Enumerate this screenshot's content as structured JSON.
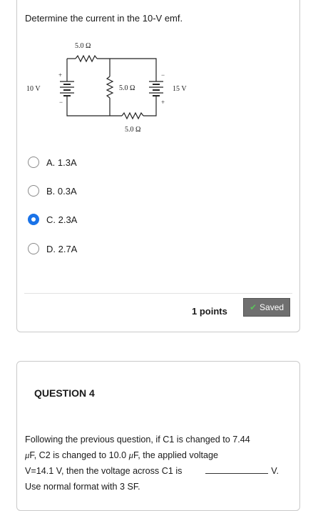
{
  "question3": {
    "text": "Determine the current in the 10-V emf.",
    "circuit": {
      "r_top": "5.0 Ω",
      "r_middle": "5.0 Ω",
      "r_bottom": "5.0 Ω",
      "emf_left": "10 V",
      "emf_right": "15 V",
      "plus": "+",
      "minus": "−"
    },
    "options": [
      {
        "label": "A. 1.3A",
        "selected": false
      },
      {
        "label": "B. 0.3A",
        "selected": false
      },
      {
        "label": "C. 2.3A",
        "selected": true
      },
      {
        "label": "D. 2.7A",
        "selected": false
      }
    ],
    "points": "1 points",
    "saved": "Saved"
  },
  "question4": {
    "title": "QUESTION 4",
    "line1": "Following the previous question, if C1 is changed to 7.44",
    "line2_a": "F, C2 is changed to 10.0",
    "line2_b": "F, the applied voltage",
    "mu": "μ",
    "line3_a": "V=14.1 V, then the voltage across C1 is",
    "line3_b": "V.",
    "line4": "Use normal format with 3 SF."
  },
  "colors": {
    "accent": "#1a73e8",
    "saved_bg": "#6f6f6f",
    "check": "#5cc15c",
    "border": "#c9c9c9"
  }
}
